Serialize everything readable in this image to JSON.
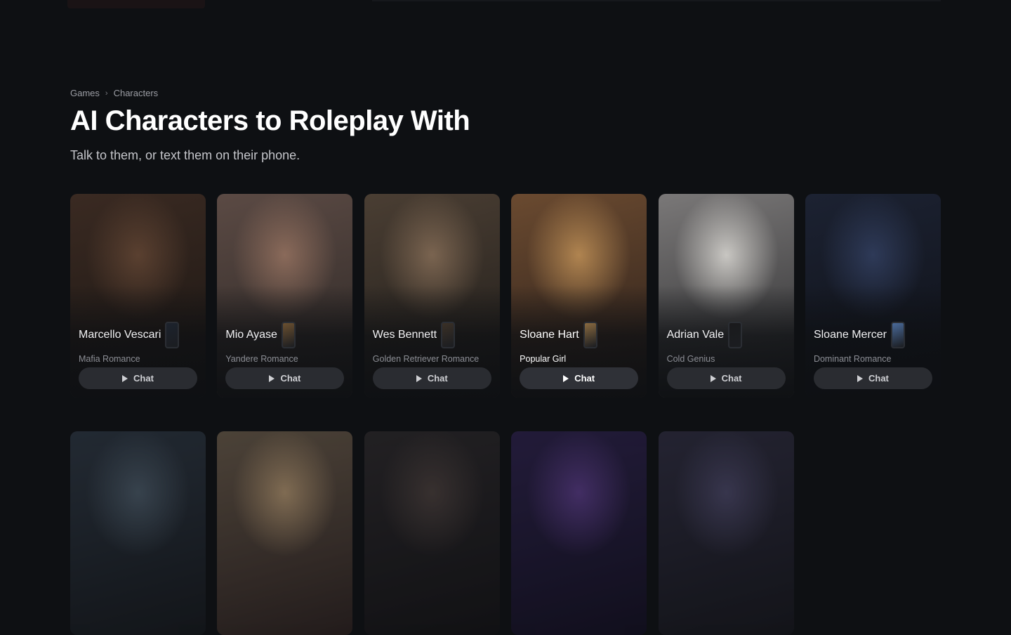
{
  "breadcrumb": {
    "items": [
      "Games",
      "Characters"
    ],
    "separator": "›"
  },
  "title": "AI Characters to Roleplay With",
  "subtitle": "Talk to them, or text them on their phone.",
  "chat_label": "Chat",
  "row1": [
    {
      "name": "Marcello Vescari",
      "genre": "Mafia Romance",
      "colors": [
        "#3a2a22",
        "#1a1512",
        "#5a4030"
      ],
      "phone_color": "#1d232d"
    },
    {
      "name": "Mio Ayase",
      "genre": "Yandere Romance",
      "colors": [
        "#5b4a44",
        "#2b2624",
        "#8a6a5a"
      ],
      "phone_color": "#6b5030"
    },
    {
      "name": "Wes Bennett",
      "genre": "Golden Retriever Romance",
      "colors": [
        "#4a3e33",
        "#1f1c19",
        "#7a6450"
      ],
      "phone_color": "#3a3026"
    },
    {
      "name": "Sloane Hart",
      "genre": "Popular Girl",
      "colors": [
        "#6a4a30",
        "#2a1e19",
        "#b08450"
      ],
      "phone_color": "#8a6a40"
    },
    {
      "name": "Adrian Vale",
      "genre": "Cold Genius",
      "colors": [
        "#7a7878",
        "#2a2a2c",
        "#c8c6c2"
      ],
      "phone_color": "#1a1a1c"
    },
    {
      "name": "Sloane Mercer",
      "genre": "Dominant Romance",
      "colors": [
        "#1c2232",
        "#0e1016",
        "#2e3a58"
      ],
      "phone_color": "#4a6a9a"
    }
  ],
  "row2": [
    {
      "colors": [
        "#2a3440",
        "#111418",
        "#4a5a68"
      ]
    },
    {
      "colors": [
        "#6a5a48",
        "#2a1e1c",
        "#b89870"
      ]
    },
    {
      "colors": [
        "#2a2628",
        "#0f0e10",
        "#4a3e3a"
      ]
    },
    {
      "colors": [
        "#2a1e4a",
        "#0f0b1e",
        "#5a3a8a"
      ]
    },
    {
      "colors": [
        "#2c2a3e",
        "#121218",
        "#4a4668"
      ]
    }
  ]
}
